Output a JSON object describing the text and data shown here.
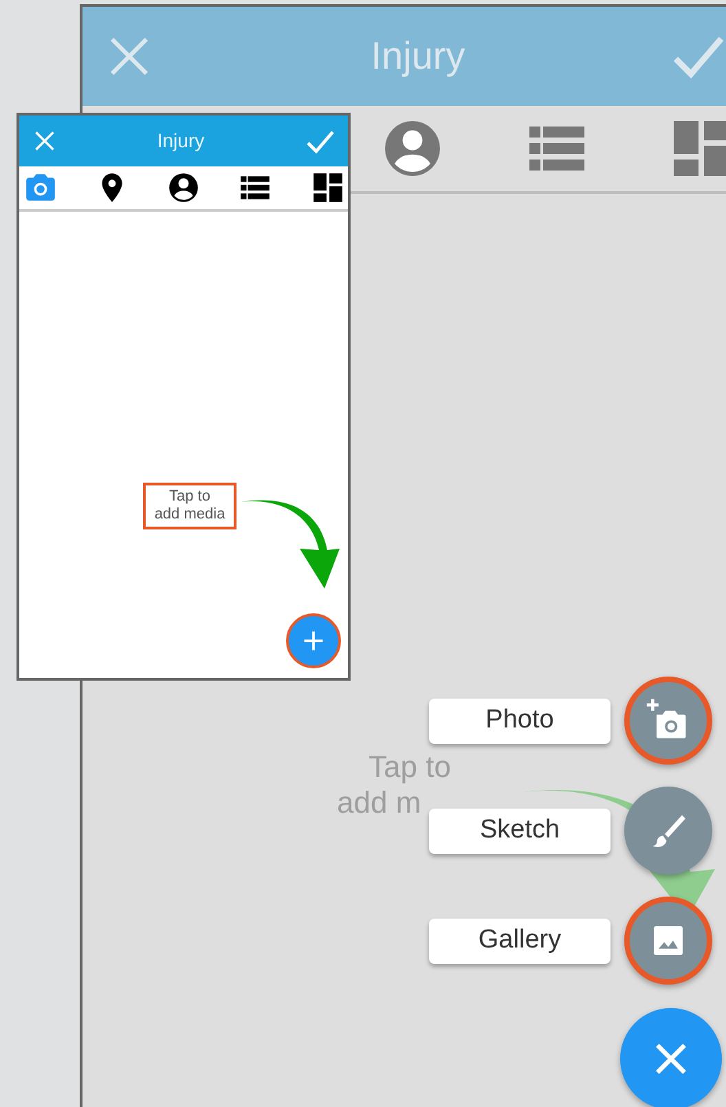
{
  "main_window": {
    "title": "Injury",
    "tabs": [
      {
        "kind": "person",
        "selected": false
      },
      {
        "kind": "list",
        "selected": false
      },
      {
        "kind": "dashboard",
        "selected": false
      }
    ]
  },
  "hint": [
    "Tap to",
    "add m"
  ],
  "fab_menu": [
    {
      "kind": "photo",
      "label": "Photo",
      "highlighted": true
    },
    {
      "kind": "sketch",
      "label": "Sketch",
      "highlighted": false
    },
    {
      "kind": "gallery",
      "label": "Gallery",
      "highlighted": true
    }
  ],
  "inset": {
    "title": "Injury",
    "tabs": [
      {
        "kind": "camera",
        "selected": true
      },
      {
        "kind": "pin",
        "selected": false
      },
      {
        "kind": "person",
        "selected": false
      },
      {
        "kind": "list",
        "selected": false
      },
      {
        "kind": "dashboard",
        "selected": false
      }
    ],
    "callout": [
      "Tap to",
      "add media"
    ],
    "fab_highlighted": true
  }
}
